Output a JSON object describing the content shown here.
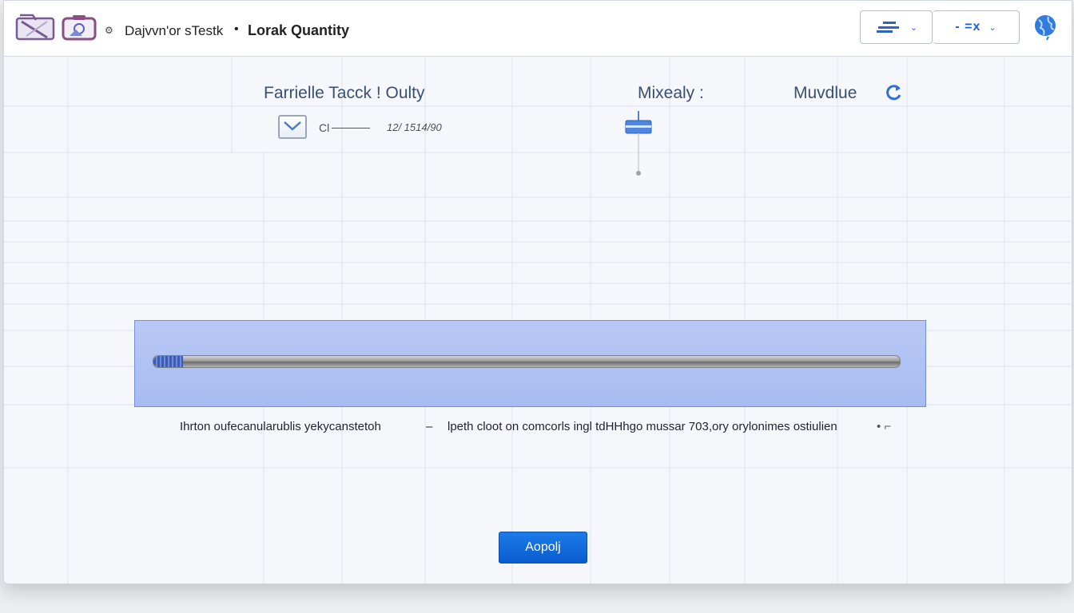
{
  "header": {
    "breadcrumb_icon": "⚙",
    "breadcrumb_first": "Dajvvn'or sTestk",
    "breadcrumb_separator": "•",
    "breadcrumb_second": "Lorak Quantity",
    "toolbar_button_1_icon": "toolbar-lines-icon",
    "toolbar_button_2_label": "- =x",
    "chevron": "⌄"
  },
  "panel": {
    "title_left": "Farrielle Tacck ! Oulty",
    "title_middle": "Mixealy :",
    "title_right": "Muvdlue",
    "checkbox_text": "Cl",
    "checkbox_value": "12/   1514/90"
  },
  "slider": {
    "level_fraction": 0.04
  },
  "helper_text": {
    "left": "Ihrton oufecanularublis yekycanstetoh",
    "dash": "–",
    "right": "lpeth cloot on comcorls ingl tdHHhgo mussar 703,ory orylonimes ostiulien",
    "end": "• ⌐"
  },
  "actions": {
    "apply_label": "Aopolj"
  },
  "colors": {
    "accent": "#1d7be8",
    "slider_panel": "#a7bcf2",
    "title_text": "#3a4f6f"
  }
}
